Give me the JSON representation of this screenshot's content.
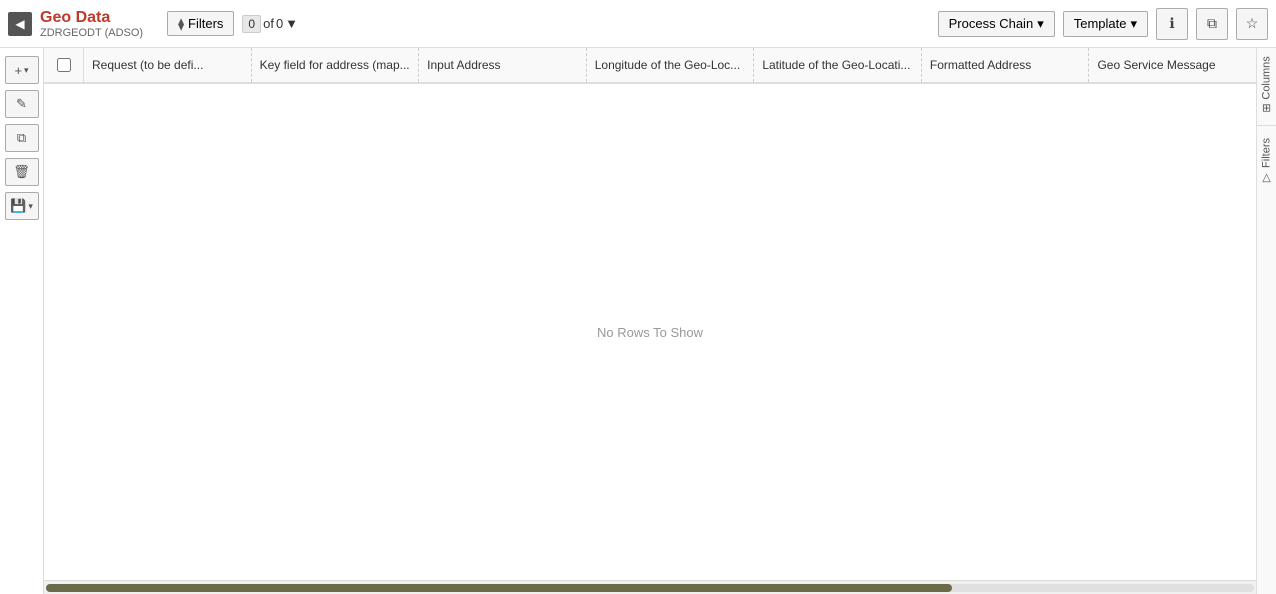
{
  "header": {
    "nav_toggle_label": "◀",
    "app_title": "Geo Data",
    "app_subtitle": "ZDRGEODT (ADSO)",
    "filter_btn_label": "Filters",
    "row_count_prefix": "0",
    "row_count_middle": "of",
    "row_count_suffix": "0",
    "row_count_filter_icon": "▼",
    "process_chain_label": "Process Chain",
    "process_chain_arrow": "▾",
    "template_label": "Template",
    "template_arrow": "▾",
    "info_icon": "ℹ",
    "export_icon": "⧉",
    "star_icon": "☆"
  },
  "toolbar": {
    "add_btn": "+",
    "add_arrow": "▾",
    "edit_btn": "✏",
    "copy_btn": "⧉",
    "delete_btn": "🗑",
    "save_btn": "💾",
    "save_arrow": "▾"
  },
  "grid": {
    "columns": [
      {
        "id": "col1",
        "label": "Request (to be defi..."
      },
      {
        "id": "col2",
        "label": "Key field for address (map..."
      },
      {
        "id": "col3",
        "label": "Input Address"
      },
      {
        "id": "col4",
        "label": "Longitude of the Geo-Loc..."
      },
      {
        "id": "col5",
        "label": "Latitude of the Geo-Locati..."
      },
      {
        "id": "col6",
        "label": "Formatted Address"
      },
      {
        "id": "col7",
        "label": "Geo Service Message"
      }
    ],
    "empty_message": "No Rows To Show"
  },
  "right_sidebar": {
    "columns_label": "Columns",
    "columns_icon": "⊞",
    "filters_label": "Filters",
    "filters_icon": "▽"
  },
  "scrollbar": {
    "thumb_width_percent": 75
  }
}
